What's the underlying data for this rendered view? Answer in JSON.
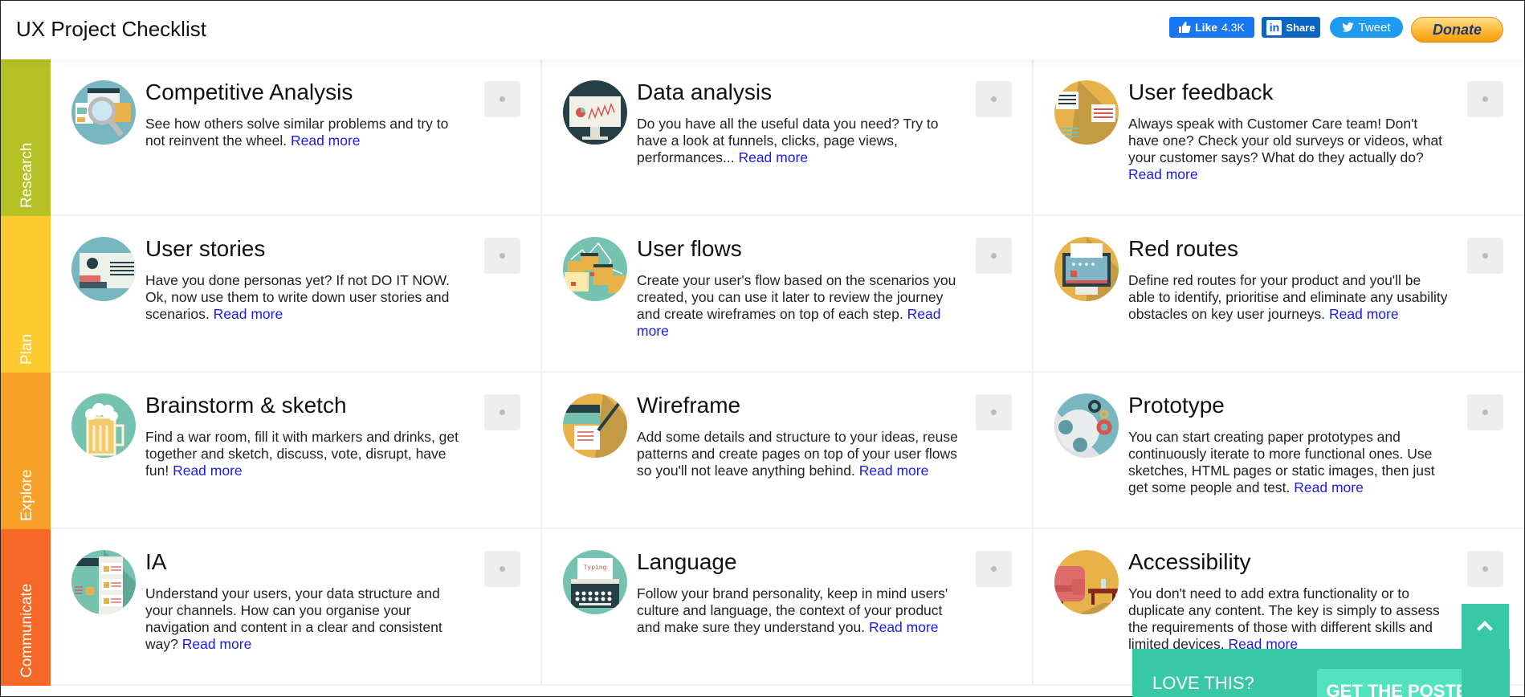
{
  "header": {
    "title": "UX Project Checklist",
    "facebook": {
      "label": "Like",
      "count": "4.3K"
    },
    "linkedin": {
      "label": "Share"
    },
    "twitter": {
      "label": "Tweet"
    },
    "donate": {
      "label": "Donate"
    }
  },
  "colors": {
    "research": "#b5c125",
    "plan": "#fdcb2f",
    "explore": "#f8a128",
    "communicate": "#f56826",
    "accent": "#37c9a6",
    "link": "#1a1aee"
  },
  "read_more_label": "Read more",
  "phases": [
    {
      "label": "Research",
      "cards": [
        {
          "title": "Competitive Analysis",
          "desc": "See how others solve similar problems and try to not reinvent the wheel.",
          "icon": "magnifier-icon"
        },
        {
          "title": "Data analysis",
          "desc": "Do you have all the useful data you need? Try to have a look at funnels, clicks, page views, performances...",
          "icon": "monitor-chart-icon"
        },
        {
          "title": "User feedback",
          "desc": "Always speak with Customer Care team! Don't have one? Check your old surveys or videos, what your customer says? What do they actually do?",
          "icon": "chat-bubbles-icon"
        }
      ]
    },
    {
      "label": "Plan",
      "cards": [
        {
          "title": "User stories",
          "desc": "Have you done personas yet? If not DO IT NOW. Ok, now use them to write down user stories and scenarios.",
          "icon": "id-card-icon"
        },
        {
          "title": "User flows",
          "desc": "Create your user's flow based on the scenarios you created, you can use it later to review the journey and create wireframes on top of each step.",
          "icon": "flow-icon"
        },
        {
          "title": "Red routes",
          "desc": "Define red routes for your product and you'll be able to identify, prioritise and eliminate any usability obstacles on key user journeys.",
          "icon": "monitor-route-icon"
        }
      ]
    },
    {
      "label": "Explore",
      "cards": [
        {
          "title": "Brainstorm & sketch",
          "desc": "Find a war room, fill it with markers and drinks, get together and sketch, discuss, vote, disrupt, have fun!",
          "icon": "beer-mug-icon"
        },
        {
          "title": "Wireframe",
          "desc": "Add some details and structure to your ideas, reuse patterns and create pages on top of your user flows so you'll not leave anything behind.",
          "icon": "wireframe-pencil-icon"
        },
        {
          "title": "Prototype",
          "desc": "You can start creating paper prototypes and continuously iterate to more functional ones. Use sketches, HTML pages or static images, then just get some people and test.",
          "icon": "gears-icon"
        }
      ]
    },
    {
      "label": "Communicate",
      "cards": [
        {
          "title": "IA",
          "desc": "Understand your users, your data structure and your channels. How can you organise your navigation and content in a clear and consistent way?",
          "icon": "sitemap-icon"
        },
        {
          "title": "Language",
          "desc": "Follow your brand personality, keep in mind users' culture and language, the context of your product and make sure they understand you.",
          "icon": "typewriter-icon",
          "icon_text": "Typing"
        },
        {
          "title": "Accessibility",
          "desc": "You don't need to add extra functionality or to duplicate any content. The key is simply to assess the requirements of those with different skills and limited devices.",
          "icon": "armchair-icon"
        }
      ]
    }
  ],
  "poster": {
    "love": "LOVE THIS?",
    "cta": "GET THE POSTER"
  },
  "back_to_top_icon": "chevron-up-icon"
}
